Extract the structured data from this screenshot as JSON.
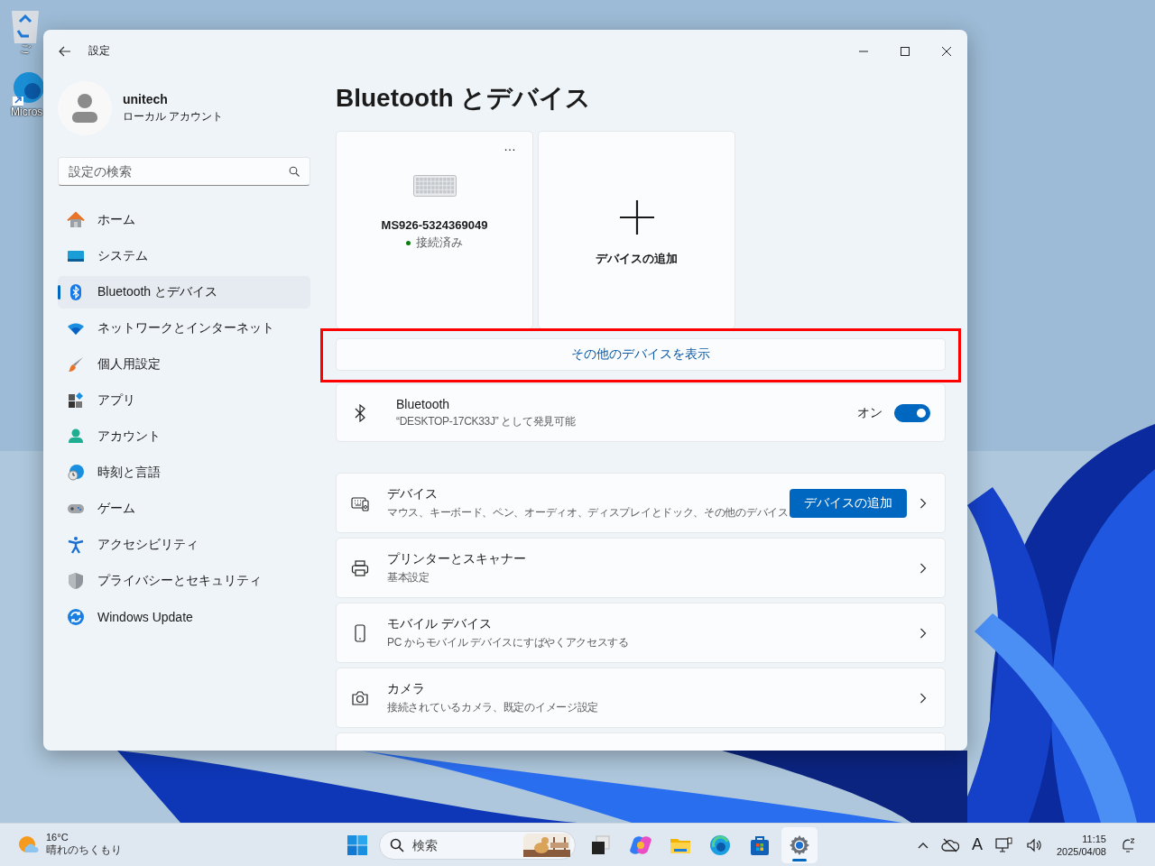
{
  "desktop": {
    "icons": [
      {
        "kind": "bin",
        "label": "ご"
      },
      {
        "kind": "edge",
        "label": "Micros"
      }
    ]
  },
  "window": {
    "title": "設定"
  },
  "account": {
    "name": "unitech",
    "type": "ローカル アカウント"
  },
  "search": {
    "placeholder": "設定の検索"
  },
  "nav": [
    {
      "kind": "home",
      "label": "ホーム",
      "selected": false
    },
    {
      "kind": "system",
      "label": "システム",
      "selected": false
    },
    {
      "kind": "bluetooth",
      "label": "Bluetooth とデバイス",
      "selected": true
    },
    {
      "kind": "wifi",
      "label": "ネットワークとインターネット",
      "selected": false
    },
    {
      "kind": "brush",
      "label": "個人用設定",
      "selected": false
    },
    {
      "kind": "apps",
      "label": "アプリ",
      "selected": false
    },
    {
      "kind": "person",
      "label": "アカウント",
      "selected": false
    },
    {
      "kind": "globe",
      "label": "時刻と言語",
      "selected": false
    },
    {
      "kind": "gamepad",
      "label": "ゲーム",
      "selected": false
    },
    {
      "kind": "access",
      "label": "アクセシビリティ",
      "selected": false
    },
    {
      "kind": "shield",
      "label": "プライバシーとセキュリティ",
      "selected": false
    },
    {
      "kind": "update",
      "label": "Windows Update",
      "selected": false
    }
  ],
  "page_title": "Bluetooth とデバイス",
  "devices": [
    {
      "kind": "device",
      "more": "…",
      "name": "MS926-5324369049",
      "status": "接続済み",
      "connected": true
    },
    {
      "kind": "add",
      "label": "デバイスの追加"
    }
  ],
  "show_more": {
    "label": "その他のデバイスを表示",
    "highlighted": true
  },
  "bluetooth": {
    "title": "Bluetooth",
    "subtitle": "“DESKTOP-17CK33J” として発見可能",
    "state_label": "オン",
    "on": true
  },
  "rows": [
    {
      "kind": "devices",
      "title": "デバイス",
      "subtitle": "マウス、キーボード、ペン、オーディオ、ディスプレイとドック、その他のデバイス",
      "button": "デバイスの追加"
    },
    {
      "kind": "printer",
      "title": "プリンターとスキャナー",
      "subtitle": "基本設定"
    },
    {
      "kind": "phone",
      "title": "モバイル デバイス",
      "subtitle": "PC からモバイル デバイスにすばやくアクセスする"
    },
    {
      "kind": "camera",
      "title": "カメラ",
      "subtitle": "接続されているカメラ、既定のイメージ設定"
    },
    {
      "kind": "partial"
    }
  ],
  "taskbar": {
    "weather": {
      "temp": "16°C",
      "condition": "晴れのちくもり"
    },
    "search_placeholder": "検索",
    "apps": [
      {
        "kind": "taskview",
        "selected": false
      },
      {
        "kind": "copilot",
        "selected": false
      },
      {
        "kind": "folder",
        "selected": false
      },
      {
        "kind": "edge",
        "selected": false
      },
      {
        "kind": "store",
        "selected": false
      },
      {
        "kind": "settings",
        "selected": true
      }
    ],
    "ime": "A",
    "time": "11:15",
    "date": "2025/04/08"
  }
}
